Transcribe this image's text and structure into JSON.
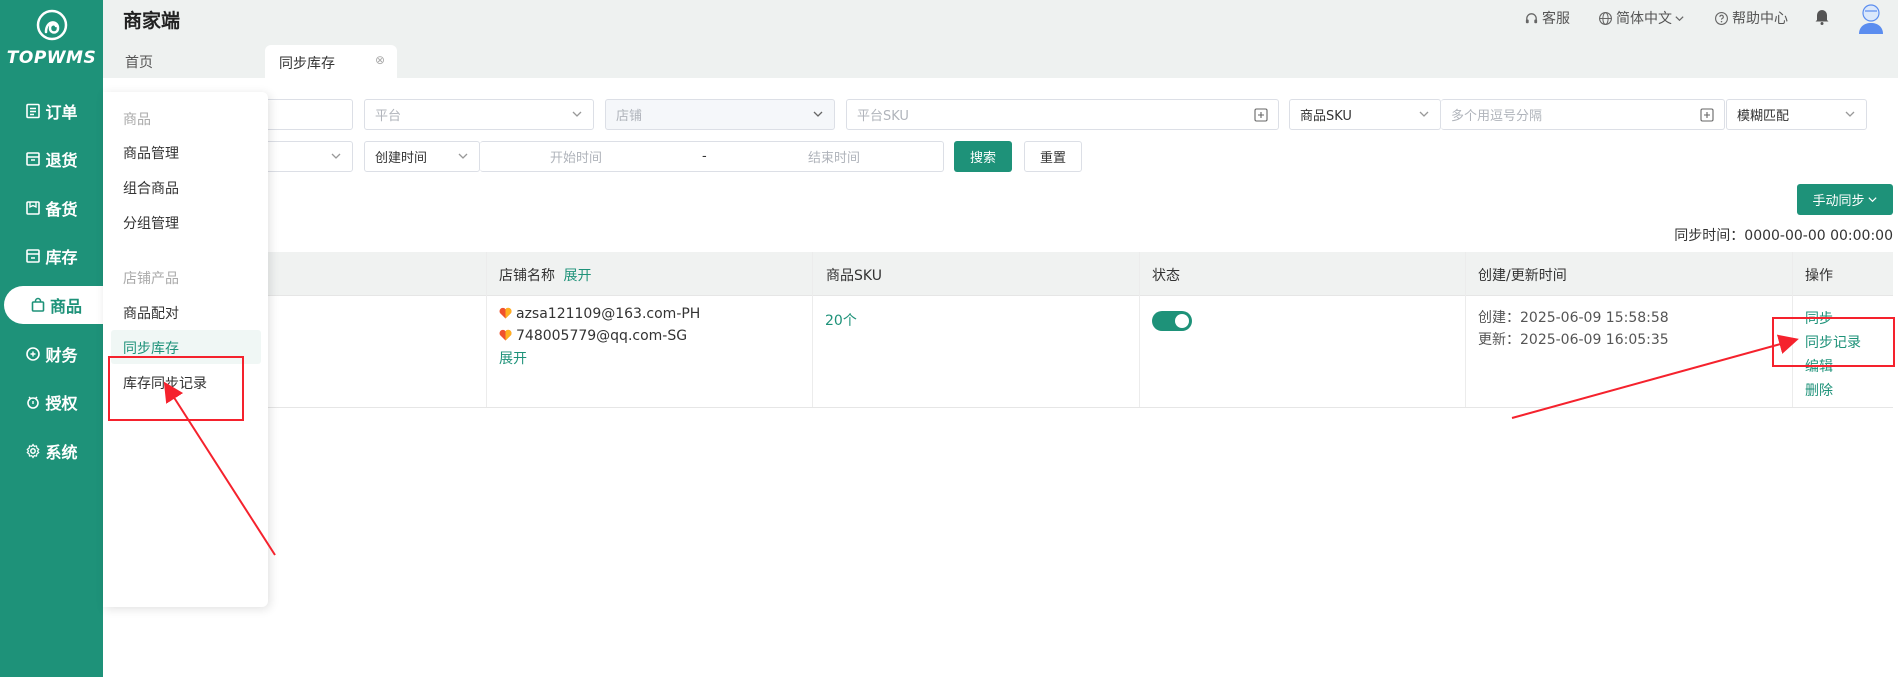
{
  "app": {
    "title": "商家端",
    "logo_text": "TOPWMS"
  },
  "sidebar": {
    "items": [
      {
        "label": "订单"
      },
      {
        "label": "退货"
      },
      {
        "label": "备货"
      },
      {
        "label": "库存"
      },
      {
        "label": "商品"
      },
      {
        "label": "财务"
      },
      {
        "label": "授权"
      },
      {
        "label": "系统"
      }
    ]
  },
  "header": {
    "customer_service": "客服",
    "language": "简体中文",
    "help": "帮助中心"
  },
  "tabs": {
    "home": "首页",
    "active": "同步库存",
    "close_glyph": "⊗"
  },
  "filters": {
    "platform_placeholder": "平台",
    "store_placeholder": "店铺",
    "platform_sku_placeholder": "平台SKU",
    "sku_type_value": "商品SKU",
    "multi_placeholder": "多个用逗号分隔",
    "match_value": "模糊匹配",
    "time_type_value": "创建时间",
    "start_placeholder": "开始时间",
    "range_sep": "-",
    "end_placeholder": "结束时间",
    "search_label": "搜索",
    "reset_label": "重置"
  },
  "toolbar": {
    "manual_sync_label": "手动同步"
  },
  "sync_time": "同步时间：0000-00-00 00:00:00",
  "table": {
    "headers": {
      "store": "店铺名称",
      "store_expand": "展开",
      "sku": "商品SKU",
      "status": "状态",
      "time": "创建/更新时间",
      "actions": "操作"
    },
    "rows": [
      {
        "stores": [
          "azsa121109@163.com-PH",
          "748005779@qq.com-SG"
        ],
        "expand": "展开",
        "sku_count": "20个",
        "status_on": true,
        "created": "创建：2025-06-09 15:58:58",
        "updated": "更新：2025-06-09 16:05:35",
        "actions": [
          "同步",
          "同步记录",
          "编辑",
          "删除"
        ]
      }
    ]
  },
  "flyout": {
    "group1": "商品",
    "items1": [
      "商品管理",
      "组合商品",
      "分组管理"
    ],
    "group2": "店铺产品",
    "items2": [
      "商品配对",
      "同步库存",
      "库存同步记录"
    ]
  },
  "colors": {
    "brand": "#1e9279",
    "annotation": "#f5222d"
  }
}
